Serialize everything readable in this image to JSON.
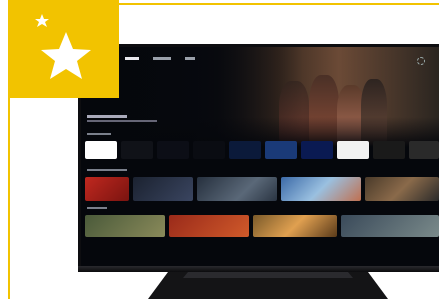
{
  "badge": {
    "color": "#f2c300",
    "icon": "star-icon"
  },
  "tv": {
    "nav": [],
    "apps_row_color": "#b3b8c2"
  }
}
